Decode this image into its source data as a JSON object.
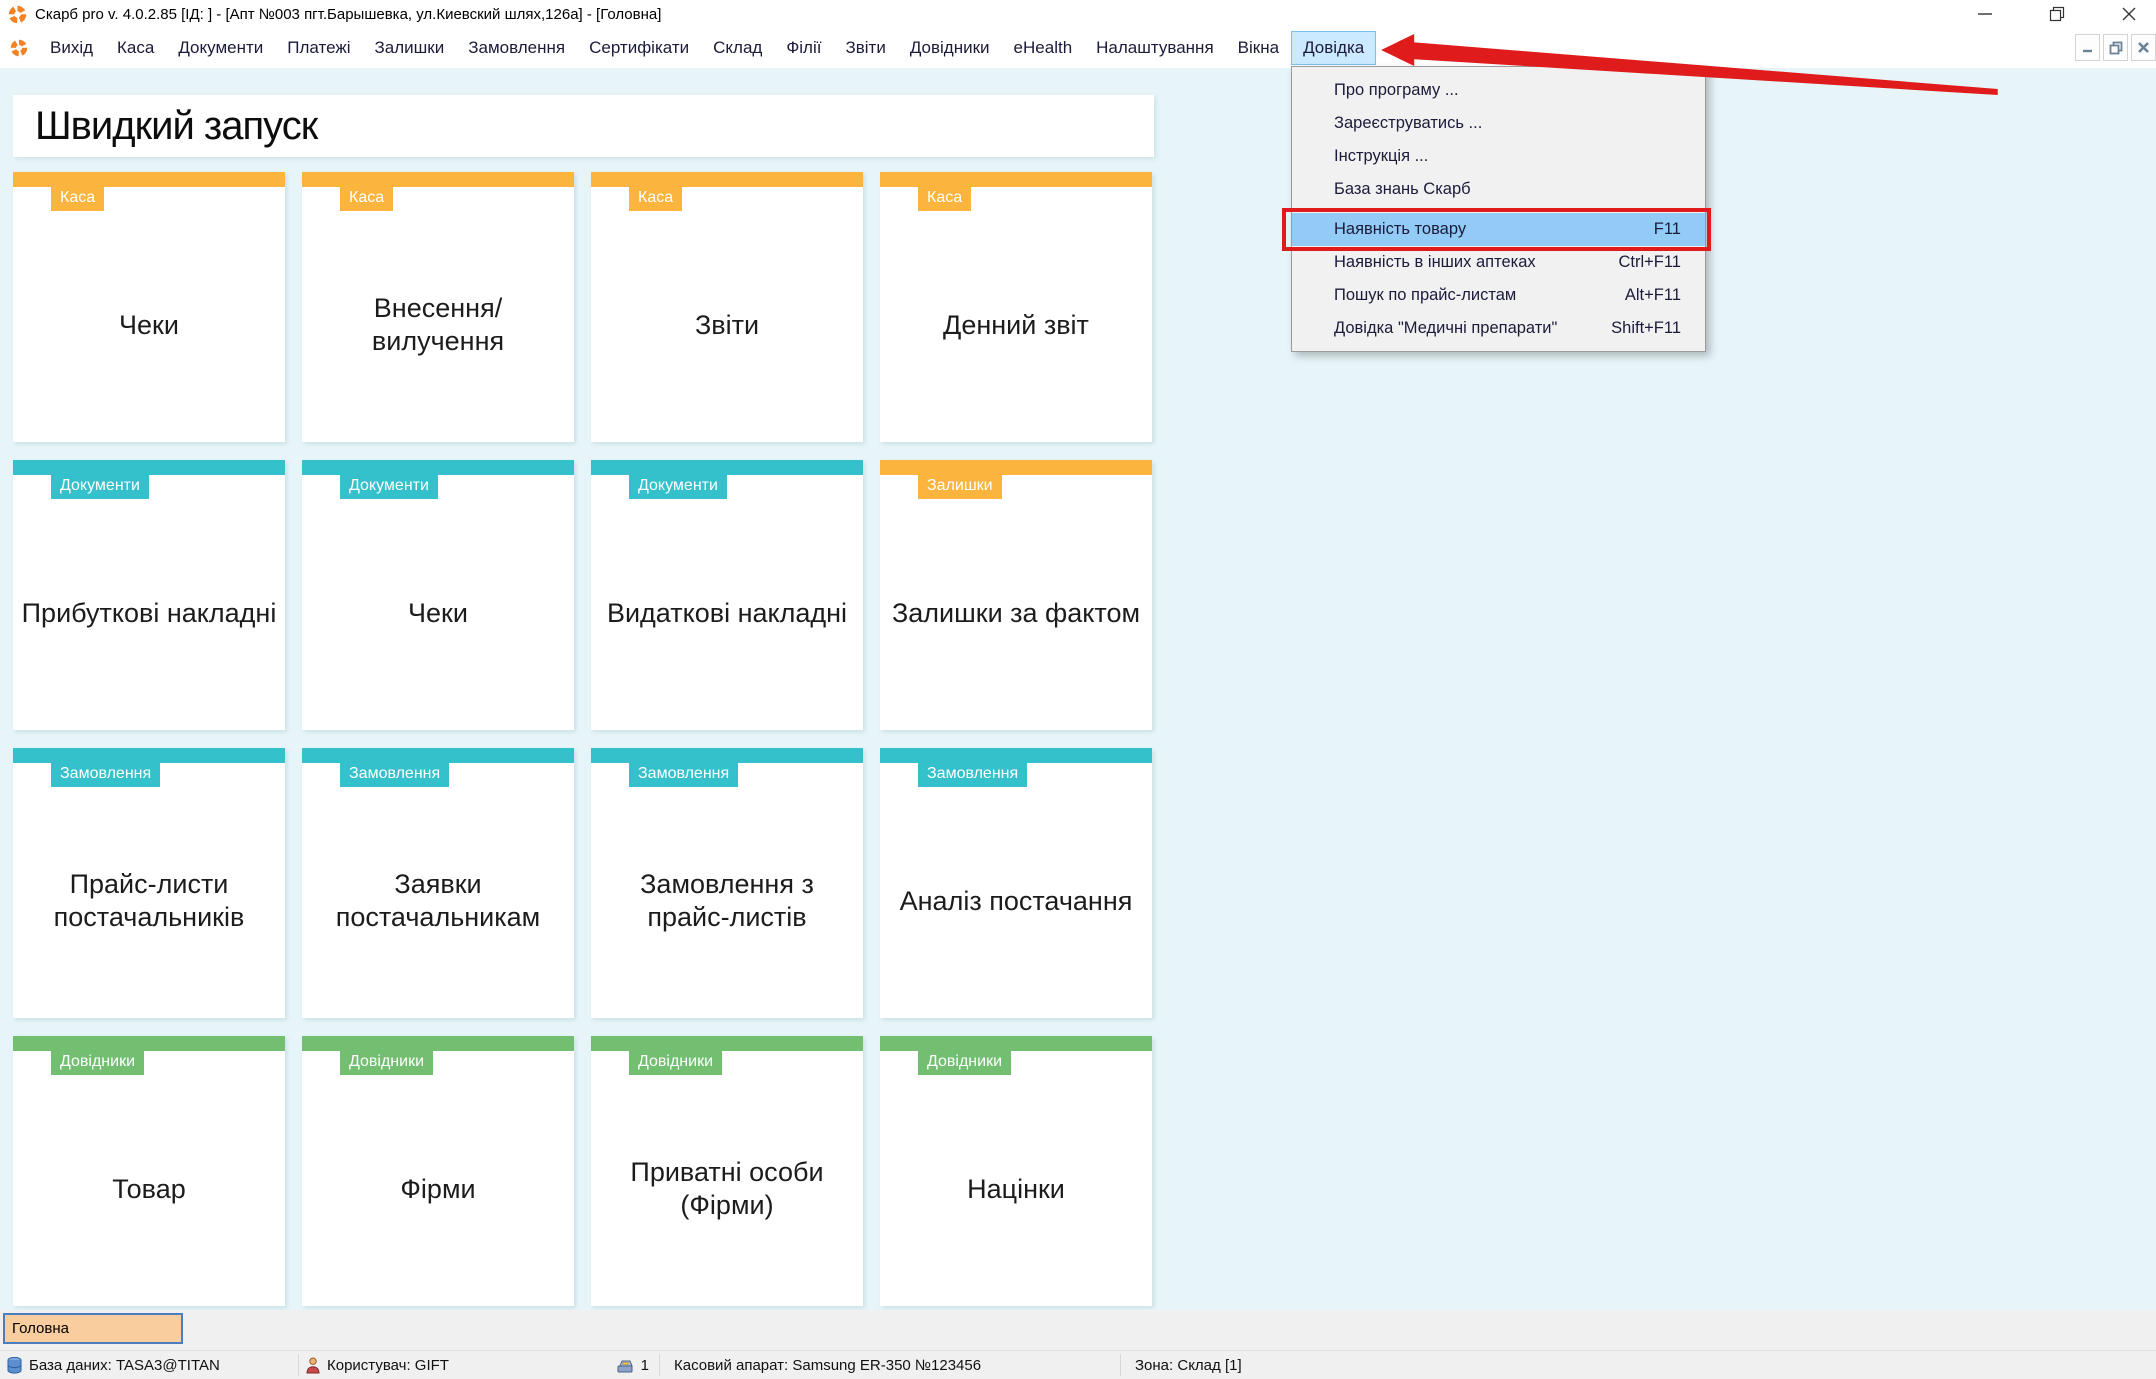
{
  "window": {
    "title": "Скарб pro v. 4.0.2.85 [ІД:      ] - [Апт №003 пгт.Барышевка, ул.Киевский шлях,126а] - [Головна]"
  },
  "menu_bar": {
    "items": [
      {
        "key": "vykhid",
        "label": "Вихід"
      },
      {
        "key": "kasa",
        "label": "Каса"
      },
      {
        "key": "dokumenty",
        "label": "Документи"
      },
      {
        "key": "platezhi",
        "label": "Платежі"
      },
      {
        "key": "zalyshky",
        "label": "Залишки"
      },
      {
        "key": "zamovlennya",
        "label": "Замовлення"
      },
      {
        "key": "sertyfikaty",
        "label": "Сертифікати"
      },
      {
        "key": "sklad",
        "label": "Склад"
      },
      {
        "key": "filii",
        "label": "Філії"
      },
      {
        "key": "zvity",
        "label": "Звіти"
      },
      {
        "key": "dovidnyky",
        "label": "Довідники"
      },
      {
        "key": "ehealth",
        "label": "eHealth"
      },
      {
        "key": "nalashtuvannya",
        "label": "Налаштування"
      },
      {
        "key": "vikna",
        "label": "Вікна"
      },
      {
        "key": "dovidka",
        "label": "Довідка",
        "active": true
      }
    ]
  },
  "help_menu": {
    "items_top": [
      {
        "key": "about",
        "label": "Про програму ..."
      },
      {
        "key": "register",
        "label": "Зареєструватись ..."
      },
      {
        "key": "instruction",
        "label": "Інструкція ..."
      },
      {
        "key": "knowledge-base",
        "label": "База знань Скарб"
      }
    ],
    "items_bottom": [
      {
        "key": "product-availability",
        "label": "Наявність товару",
        "shortcut": "F11",
        "highlighted": true
      },
      {
        "key": "availability-other-pharmacies",
        "label": "Наявність в інших аптеках",
        "shortcut": "Ctrl+F11"
      },
      {
        "key": "price-list-search",
        "label": "Пошук по прайс-листам",
        "shortcut": "Alt+F11"
      },
      {
        "key": "medical-drugs-help",
        "label": "Довідка \"Медичні препарати\"",
        "shortcut": "Shift+F11"
      }
    ]
  },
  "quick_launch": {
    "title": "Швидкий запуск",
    "tiles": [
      {
        "key": "kasa-cheky",
        "category": "Каса",
        "color": "orange",
        "label": "Чеки"
      },
      {
        "key": "kasa-vnesennya",
        "category": "Каса",
        "color": "orange",
        "label": "Внесення/вилучення"
      },
      {
        "key": "kasa-zvity",
        "category": "Каса",
        "color": "orange",
        "label": "Звіти"
      },
      {
        "key": "kasa-dennyi-zvit",
        "category": "Каса",
        "color": "orange",
        "label": "Денний звіт"
      },
      {
        "key": "doc-prybutkovi",
        "category": "Документи",
        "color": "teal",
        "label": "Прибуткові накладні"
      },
      {
        "key": "doc-cheky",
        "category": "Документи",
        "color": "teal",
        "label": "Чеки"
      },
      {
        "key": "doc-vydatkovi",
        "category": "Документи",
        "color": "teal",
        "label": "Видаткові накладні"
      },
      {
        "key": "zalyshky-za-faktom",
        "category": "Залишки",
        "color": "orange",
        "label": "Залишки за фактом"
      },
      {
        "key": "zam-prais-lysty",
        "category": "Замовлення",
        "color": "teal",
        "label": "Прайс-листи постачальників"
      },
      {
        "key": "zam-zaiavky",
        "category": "Замовлення",
        "color": "teal",
        "label": "Заявки постачальникам"
      },
      {
        "key": "zam-z-prais-lystiv",
        "category": "Замовлення",
        "color": "teal",
        "label": "Замовлення з прайс-листів"
      },
      {
        "key": "zam-analiz",
        "category": "Замовлення",
        "color": "teal",
        "label": "Аналіз постачання"
      },
      {
        "key": "dov-tovar",
        "category": "Довідники",
        "color": "green",
        "label": "Товар"
      },
      {
        "key": "dov-firmy",
        "category": "Довідники",
        "color": "green",
        "label": "Фірми"
      },
      {
        "key": "dov-pryvatni",
        "category": "Довідники",
        "color": "green",
        "label": "Приватні особи (Фірми)"
      },
      {
        "key": "dov-natsinky",
        "category": "Довідники",
        "color": "green",
        "label": "Націнки"
      }
    ]
  },
  "footer_tab": {
    "label": "Головна"
  },
  "status_bar": {
    "database": "База даних: TASA3@TITAN",
    "user": "Користувач: GIFT",
    "register_count": "1",
    "cash_register": "Касовий апарат: Samsung ER-350 №123456",
    "zone": "Зона: Склад [1]"
  },
  "colors": {
    "orange": "#fbb43e",
    "teal": "#35c1cc",
    "green": "#72bf72",
    "main_background": "#e7f5f9",
    "menu_highlight": "#cbe9ff",
    "dropdown_highlight": "#92cbf6",
    "annotation_red": "#e01b1b",
    "footer_tab_background": "#facd9e",
    "footer_tab_border": "#4e7dbe",
    "logo_orange": "#f58220"
  }
}
